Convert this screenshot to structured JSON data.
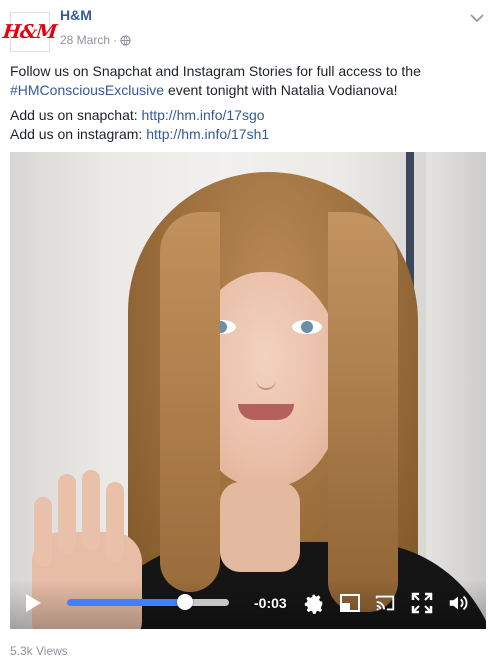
{
  "post": {
    "page_name": "H&M",
    "logo_text": "H&M",
    "date": "28 March",
    "separator": "·",
    "text_line1": "Follow us on Snapchat and Instagram Stories for full access to the",
    "hashtag": "#HMConsciousExclusive",
    "text_line2_rest": " event tonight with Natalia Vodianova!",
    "snapchat_label": "Add us on snapchat: ",
    "snapchat_link": "http://hm.info/17sgo",
    "instagram_label": "Add us on instagram: ",
    "instagram_link": "http://hm.info/17sh1"
  },
  "video": {
    "time_remaining": "-0:03",
    "progress_fraction": 0.73
  },
  "footer": {
    "views": "5.3k Views"
  },
  "icons": [
    "globe-icon",
    "chevron-down-icon",
    "play-icon",
    "settings-icon",
    "pip-icon",
    "cast-icon",
    "fullscreen-icon",
    "volume-icon"
  ],
  "colors": {
    "link": "#365899",
    "progress": "#4080ff",
    "brand": "#e50010",
    "muted": "#90949c"
  }
}
